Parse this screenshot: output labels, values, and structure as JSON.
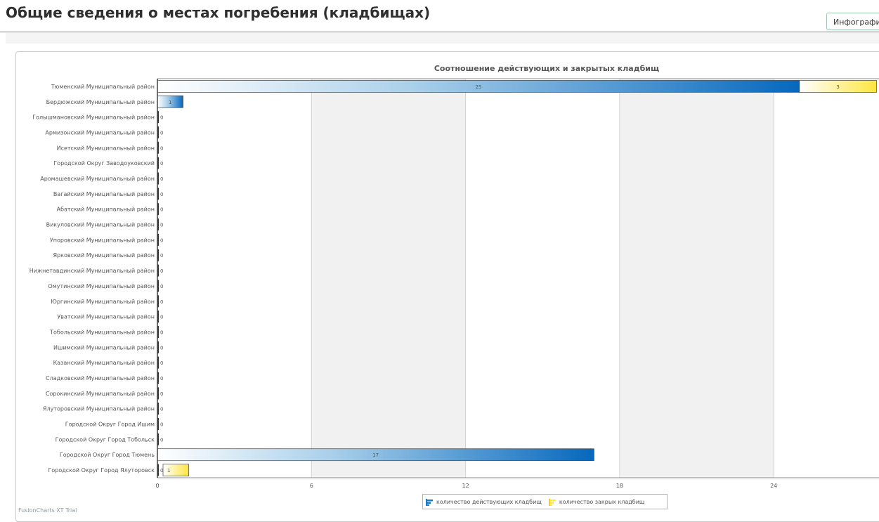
{
  "page": {
    "title": "Общие сведения о местах погребения (кладбищах)",
    "infographic_label": "Инфографика"
  },
  "watermark": "FusionCharts XT Trial",
  "legend": [
    {
      "label": "количество действующих кладбищ",
      "icon": "blue-bar-icon",
      "color": "#1a78c8"
    },
    {
      "label": "количество закрых кладбищ",
      "icon": "yellow-bar-icon",
      "color": "#fde74c"
    }
  ],
  "chart_data": {
    "type": "bar",
    "orientation": "horizontal",
    "stacked": true,
    "title": "Соотношение действующих и закрытых кладбищ",
    "categories": [
      "Тюменский Муниципальный район",
      "Бердюжский Муниципальный район",
      "Голышмановский Муниципальный район",
      "Армизонский Муниципальный район",
      "Исетский Муниципальный район",
      "Городской Округ Заводоуковский",
      "Аромашевский Муниципальный район",
      "Вагайский Муниципальный район",
      "Абатский Муниципальный район",
      "Викуловский Муниципальный район",
      "Упоровский Муниципальный район",
      "Ярковский Муниципальный район",
      "Нижнетавдинский Муниципальный район",
      "Омутинский Муниципальный район",
      "Юргинский Муниципальный район",
      "Уватский Муниципальный район",
      "Тобольский Муниципальный район",
      "Ишимский Муниципальный район",
      "Казанский Муниципальный район",
      "Сладковский Муниципальный район",
      "Сорокинский Муниципальный район",
      "Ялуторовский Муниципальный район",
      "Городской Округ Город Ишим",
      "Городской Округ Город Тобольск",
      "Городской Округ Город Тюмень",
      "Городской Округ Город Ялуторовск"
    ],
    "series": [
      {
        "name": "количество действующих кладбищ",
        "color": "#1a78c8",
        "values": [
          25,
          1,
          0,
          0,
          0,
          0,
          0,
          0,
          0,
          0,
          0,
          0,
          0,
          0,
          0,
          0,
          0,
          0,
          0,
          0,
          0,
          0,
          0,
          0,
          17,
          0
        ]
      },
      {
        "name": "количество закрых кладбищ",
        "color": "#fde74c",
        "values": [
          3,
          null,
          null,
          null,
          null,
          null,
          null,
          null,
          null,
          null,
          null,
          null,
          null,
          null,
          null,
          null,
          null,
          null,
          null,
          null,
          null,
          null,
          null,
          null,
          null,
          1
        ]
      }
    ],
    "xlim": [
      0,
      28
    ],
    "xticks": [
      0,
      6,
      12,
      18,
      24
    ],
    "grid": true,
    "legend_position": "bottom"
  }
}
